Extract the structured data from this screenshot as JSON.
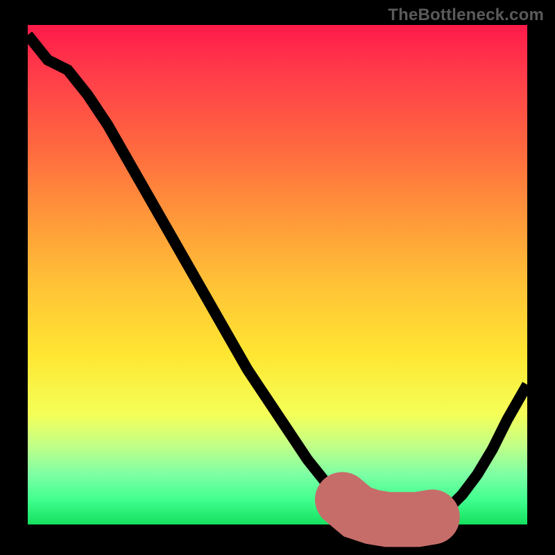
{
  "branding": {
    "text": "TheBottleneck.com"
  },
  "chart_data": {
    "type": "line",
    "title": "",
    "xlabel": "",
    "ylabel": "",
    "xlim": [
      0,
      100
    ],
    "ylim": [
      0,
      100
    ],
    "grid": false,
    "legend": false,
    "background": "gradient-red-yellow-green",
    "note": "x in arbitrary horizontal percent of plot width, y in percent from top (0=top)",
    "series": [
      {
        "name": "bottleneck-curve",
        "color": "#000000",
        "x": [
          0,
          4,
          8,
          12,
          16,
          20,
          24,
          28,
          32,
          36,
          40,
          44,
          48,
          52,
          56,
          60,
          63,
          66,
          69,
          72,
          75,
          78,
          81,
          84,
          87,
          90,
          93,
          96,
          100
        ],
        "y": [
          2,
          7,
          9,
          14,
          20,
          27,
          34,
          41,
          48,
          55,
          62,
          69,
          75,
          81,
          87,
          92,
          95,
          97.5,
          98.5,
          99,
          99,
          99,
          98.5,
          97,
          94,
          90,
          85,
          79,
          72
        ]
      },
      {
        "name": "optimal-range-highlight",
        "color": "#c66d6a",
        "x": [
          63,
          66,
          69,
          72,
          75,
          78,
          81
        ],
        "y": [
          95,
          97.5,
          98.5,
          99,
          99,
          99,
          98.5
        ]
      }
    ]
  }
}
